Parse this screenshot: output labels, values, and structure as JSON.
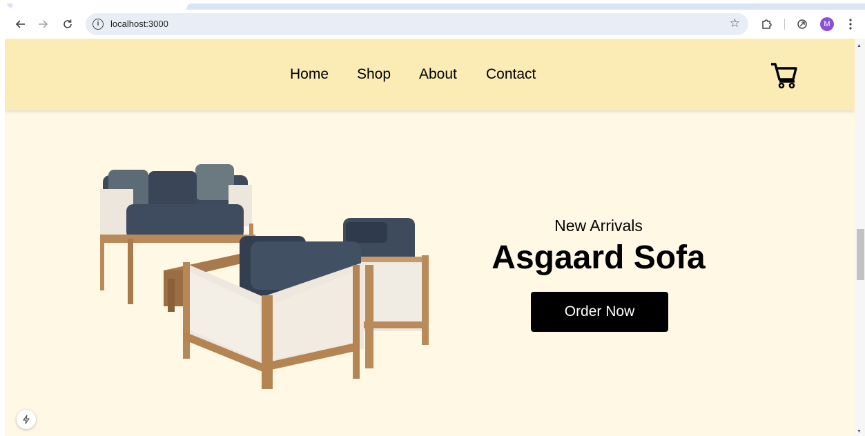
{
  "browser": {
    "url": "localhost:3000",
    "profile_initial": "M",
    "icons": {
      "back": "arrow-left-icon",
      "forward": "arrow-right-icon",
      "reload": "reload-icon",
      "site_info": "info-icon",
      "bookmark": "star-icon",
      "extensions": "puzzle-icon",
      "performance": "leaf-icon",
      "menu": "kebab-menu-icon"
    },
    "colors": {
      "avatar": "#8b50d8",
      "omnibox": "#e9eef6"
    }
  },
  "site": {
    "nav": [
      {
        "label": "Home"
      },
      {
        "label": "Shop"
      },
      {
        "label": "About"
      },
      {
        "label": "Contact"
      }
    ],
    "cart_icon": "shopping-cart-icon",
    "colors": {
      "header_bg": "#fbebb5",
      "page_bg": "#fff8e5",
      "button_bg": "#000000"
    }
  },
  "hero": {
    "subtitle": "New Arrivals",
    "title": "Asgaard Sofa",
    "cta": "Order Now",
    "image_icon": "sofa-set-image"
  },
  "dev_badge_icon": "lightning-icon"
}
